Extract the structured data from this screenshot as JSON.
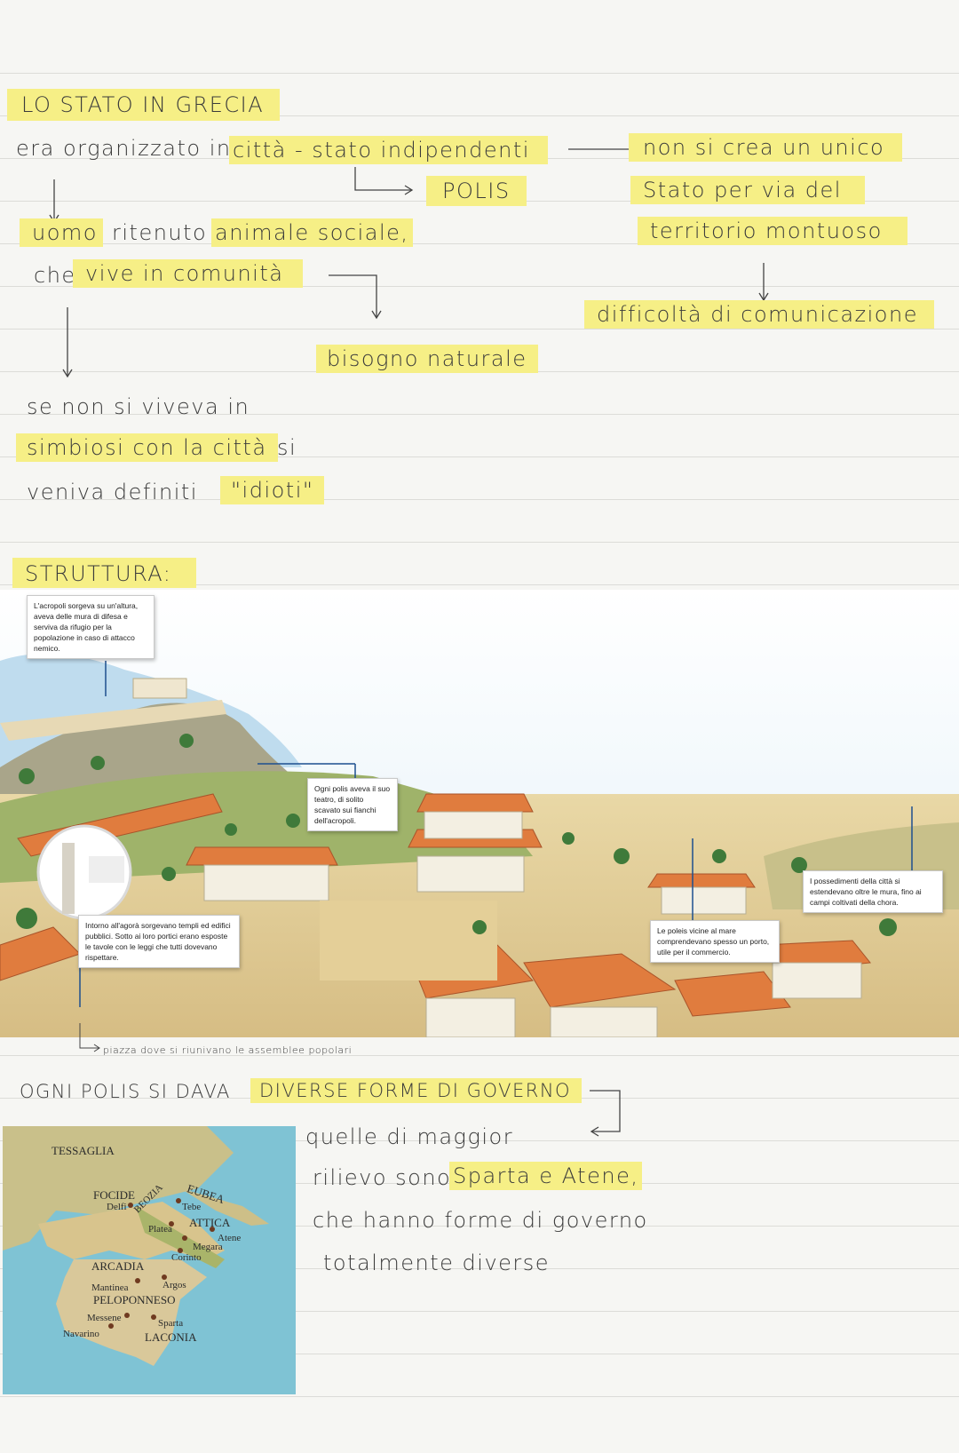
{
  "notes": {
    "title": "LO STATO IN GRECIA",
    "line1_prefix": "era organizzato in",
    "line1_highlight": "città - stato indipendenti",
    "polis": "POLIS",
    "right1": "non si crea un unico",
    "right2": "Stato per via del",
    "right3": "territorio montuoso",
    "right4": "difficoltà di comunicazione",
    "uomo": "uomo",
    "ritenuto": "ritenuto",
    "animale_sociale": "animale sociale,",
    "che": "che",
    "vive_in_comunita": "vive in comunità",
    "bisogno_naturale": "bisogno naturale",
    "se_non": "se non si viveva in",
    "simbiosi": "simbiosi con la città",
    "si": "si",
    "veniva_definiti": "veniva definiti",
    "idioti": "\"idioti\"",
    "struttura": "STRUTTURA:",
    "piazza_note": "piazza dove si riunivano le assemblee popolari",
    "governo_prefix": "OGNI POLIS SI DAVA",
    "governo_highlight": "DIVERSE FORME DI GOVERNO",
    "quelle": "quelle di maggior",
    "rilievo": "rilievo sono",
    "sparta_atene": "Sparta e Atene,",
    "che_hanno": "che hanno forme di governo",
    "totalmente": "totalmente diverse"
  },
  "illustration": {
    "acropoli": "L'acropoli sorgeva su un'altura, aveva delle mura di difesa e serviva da rifugio per la popolazione in caso di attacco nemico.",
    "teatro": "Ogni polis aveva il suo teatro, di solito scavato sui fianchi dell'acropoli.",
    "agora": "Intorno all'agorà sorgevano templi ed edifici pubblici. Sotto ai loro portici erano esposte le tavole con le leggi che tutti dovevano rispettare.",
    "porto": "Le poleis vicine al mare comprendevano spesso un porto, utile per il commercio.",
    "chora": "I possedimenti della città si estendevano oltre le mura, fino ai campi coltivati della chora."
  },
  "map": {
    "labels": [
      "TESSAGLIA",
      "FOCIDE",
      "Delfi",
      "BEOZIA",
      "Tebe",
      "EUBEA",
      "Platea",
      "ATTICA",
      "Atene",
      "Megara",
      "Corinto",
      "ARCADIA",
      "Argos",
      "Mantinea",
      "PELOPONNESO",
      "Messene",
      "Sparta",
      "Navarino",
      "LACONIA"
    ]
  },
  "colors": {
    "highlight": "#f6ef86",
    "paper": "#f6f6f3",
    "ink": "#3b3b3b",
    "sea": "#7fc3d4",
    "land": "#d9c89a"
  }
}
